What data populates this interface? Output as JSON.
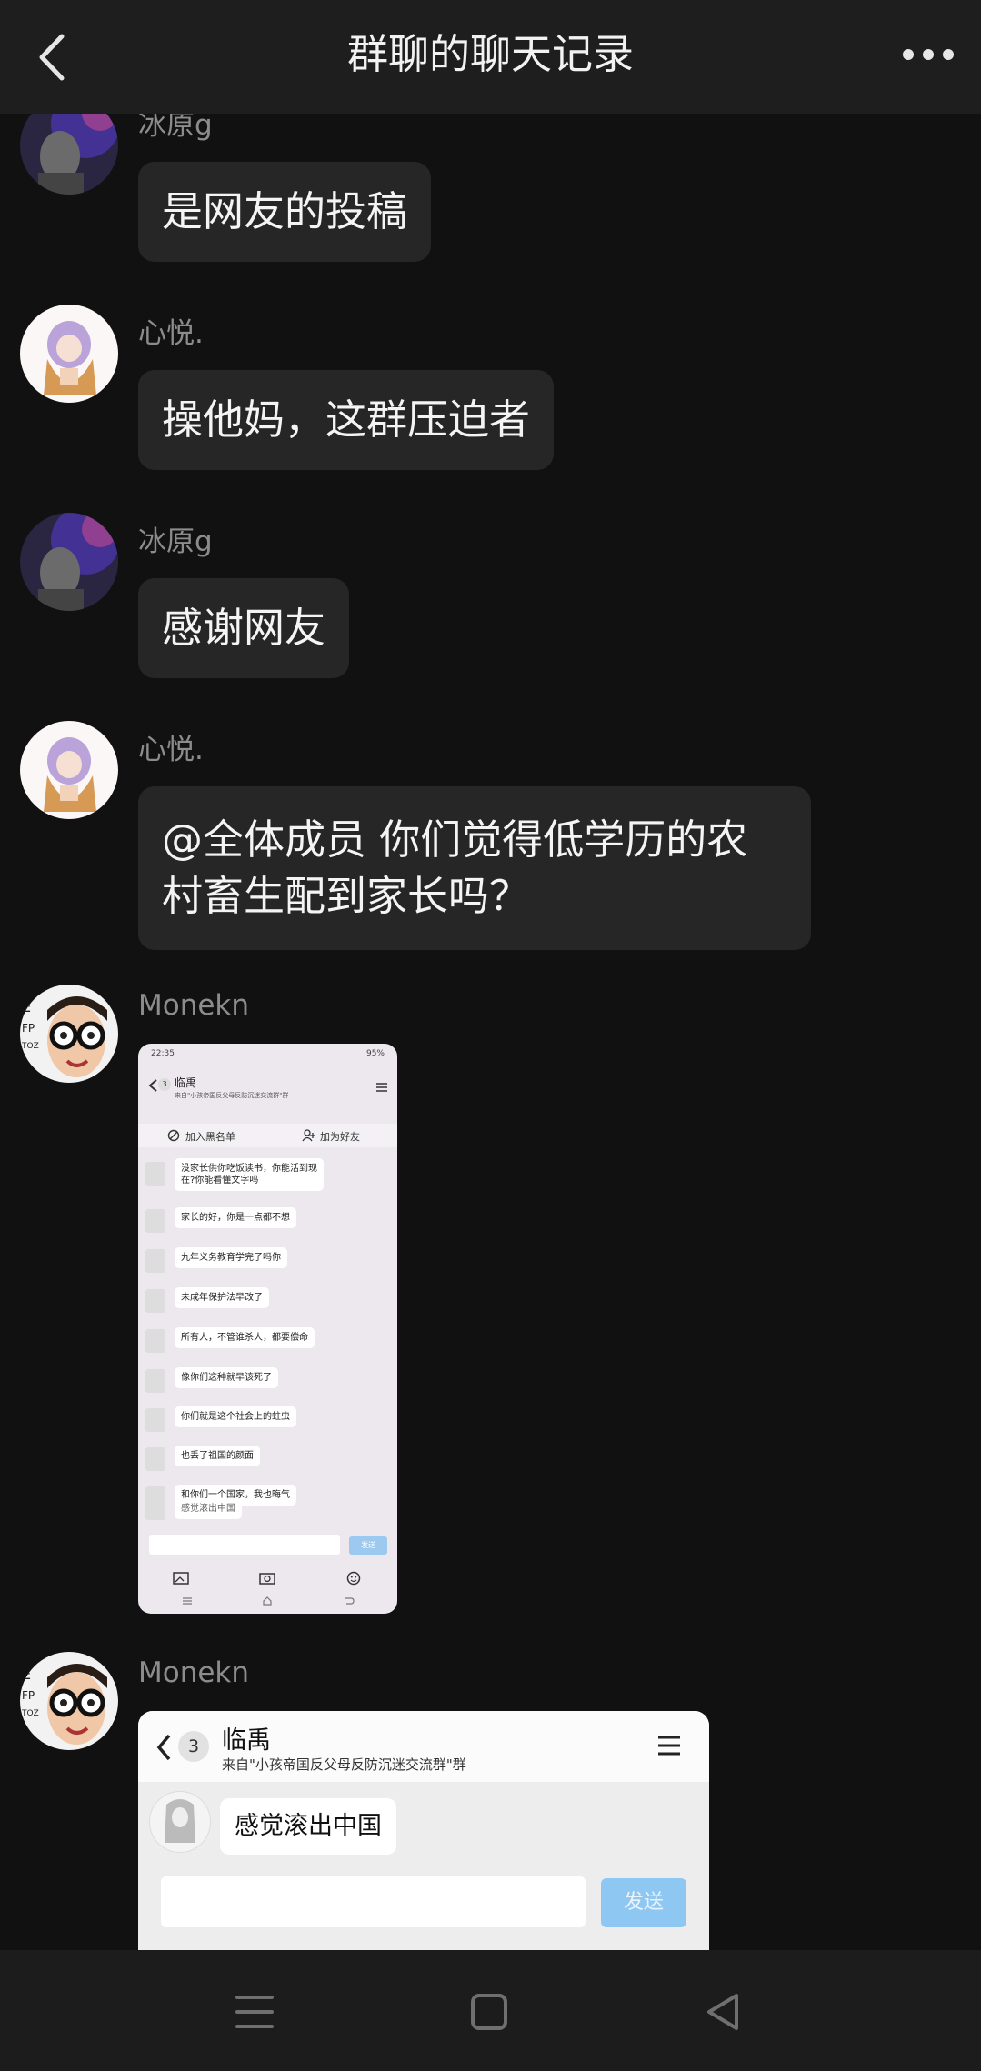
{
  "header": {
    "title": "群聊的聊天记录"
  },
  "messages": [
    {
      "sender": "冰原g",
      "text": "是网友的投稿"
    },
    {
      "sender": "心悦.",
      "text": "操他妈，这群压迫者"
    },
    {
      "sender": "冰原g",
      "text": "感谢网友"
    },
    {
      "sender": "心悦.",
      "text_line1": "@全体成员 你们觉得低学历的农",
      "text_line2": "村畜生配到家长吗？"
    },
    {
      "sender": "Monekn"
    },
    {
      "sender": "Monekn"
    }
  ],
  "screenshot1": {
    "time": "22:35",
    "battery": "95%",
    "badge": "3",
    "title": "临禹",
    "subtitle": "来自\"小孩帝国反父母反防沉迷交流群\"群",
    "blacklist": "加入黑名单",
    "add_friend": "加为好友",
    "messages": [
      "没家长供你吃饭读书，你能活到现\n在?你能看懂文字吗",
      "家长的好，你是一点都不想",
      "九年义务教育学完了吗你",
      "未成年保护法早改了",
      "所有人，不管谁杀人，都要偿命",
      "像你们这种就早该死了",
      "你们就是这个社会上的蛀虫",
      "也丢了祖国的颜面",
      "和你们一个国家，我也晦气",
      "感觉滚出中国"
    ],
    "send": "发送"
  },
  "screenshot2": {
    "badge": "3",
    "title": "临禹",
    "subtitle": "来自\"小孩帝国反父母反防沉迷交流群\"群",
    "message": "感觉滚出中国",
    "send": "发送"
  },
  "icons": {
    "back": "chevron-left-icon",
    "more": "more-dots-icon",
    "nav_menu": "menu-lines-icon",
    "nav_home": "square-home-icon",
    "nav_back": "triangle-back-icon"
  },
  "colors": {
    "background": "#111111",
    "header": "#1e1e1e",
    "bubble": "#262626",
    "sender": "#8c8c8c"
  }
}
